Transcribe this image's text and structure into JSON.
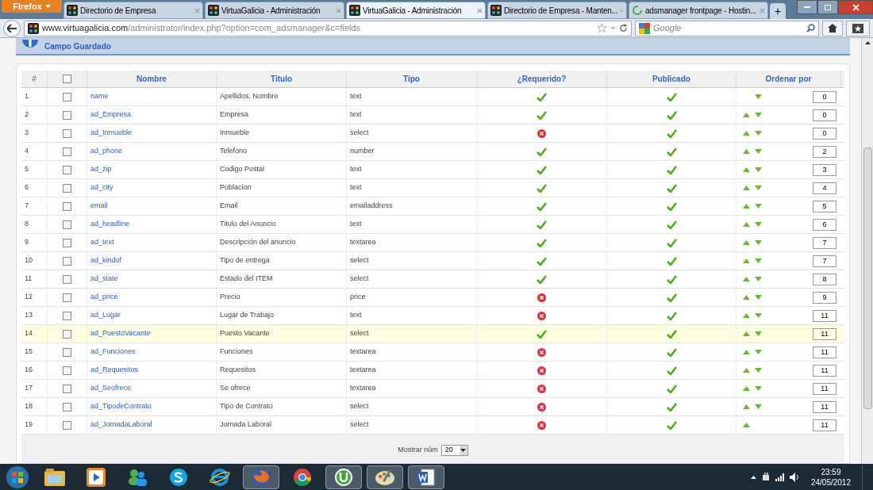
{
  "browser": {
    "menu_button": "Firefox",
    "tabs": [
      {
        "title": "Directorio de Empresa",
        "kind": "site",
        "selected": false
      },
      {
        "title": "VirtuaGalicia - Administración",
        "kind": "site",
        "selected": false
      },
      {
        "title": "VirtuaGalicia - Administración",
        "kind": "site",
        "selected": true
      },
      {
        "title": "Directorio de Empresa - Manten...",
        "kind": "site",
        "selected": false
      },
      {
        "title": "adsmanager frontpage - Hostin...",
        "kind": "loading",
        "selected": false
      }
    ],
    "new_tab": "+",
    "address_domain": "www.virtuagalicia.com",
    "address_path": "/administrator/index.php?option=com_adsmanager&c=fields",
    "search_placeholder": "Google"
  },
  "message": "Campo Guardado",
  "table": {
    "select_all_checked": false,
    "columns": [
      "#",
      "Nombre",
      "Titulo",
      "Tipo",
      "¿Requerido?",
      "Publicado",
      "Ordenar por"
    ],
    "rows": [
      {
        "num": "1",
        "name": "name",
        "title": "Apellidos, Nombre",
        "type": "text",
        "required": true,
        "published": true,
        "move_up": false,
        "move_down": true,
        "order": "0",
        "highlighted": false
      },
      {
        "num": "2",
        "name": "ad_Empresa",
        "title": "Empresa",
        "type": "text",
        "required": true,
        "published": true,
        "move_up": true,
        "move_down": true,
        "order": "0",
        "highlighted": false
      },
      {
        "num": "3",
        "name": "ad_Inmueble",
        "title": "Inmueble",
        "type": "select",
        "required": false,
        "published": true,
        "move_up": true,
        "move_down": true,
        "order": "0",
        "highlighted": false
      },
      {
        "num": "4",
        "name": "ad_phone",
        "title": "Telefono",
        "type": "number",
        "required": true,
        "published": true,
        "move_up": true,
        "move_down": true,
        "order": "2",
        "highlighted": false
      },
      {
        "num": "5",
        "name": "ad_zip",
        "title": "Codigo Postal",
        "type": "text",
        "required": true,
        "published": true,
        "move_up": true,
        "move_down": true,
        "order": "3",
        "highlighted": false
      },
      {
        "num": "6",
        "name": "ad_city",
        "title": "Poblacion",
        "type": "text",
        "required": true,
        "published": true,
        "move_up": true,
        "move_down": true,
        "order": "4",
        "highlighted": false
      },
      {
        "num": "7",
        "name": "email",
        "title": "Email",
        "type": "emailaddress",
        "required": true,
        "published": true,
        "move_up": true,
        "move_down": true,
        "order": "5",
        "highlighted": false
      },
      {
        "num": "8",
        "name": "ad_headline",
        "title": "Titulo del Anuncio",
        "type": "text",
        "required": true,
        "published": true,
        "move_up": true,
        "move_down": true,
        "order": "6",
        "highlighted": false
      },
      {
        "num": "9",
        "name": "ad_text",
        "title": "Descripción del anuncio",
        "type": "textarea",
        "required": true,
        "published": true,
        "move_up": true,
        "move_down": true,
        "order": "7",
        "highlighted": false
      },
      {
        "num": "10",
        "name": "ad_kindof",
        "title": "Tipo de entrega",
        "type": "select",
        "required": true,
        "published": true,
        "move_up": true,
        "move_down": true,
        "order": "7",
        "highlighted": false
      },
      {
        "num": "11",
        "name": "ad_state",
        "title": "Estado del ITEM",
        "type": "select",
        "required": true,
        "published": true,
        "move_up": true,
        "move_down": true,
        "order": "8",
        "highlighted": false
      },
      {
        "num": "12",
        "name": "ad_price",
        "title": "Precio",
        "type": "price",
        "required": false,
        "published": true,
        "move_up": true,
        "move_down": true,
        "order": "9",
        "highlighted": false
      },
      {
        "num": "13",
        "name": "ad_Lugar",
        "title": "Lugar de Trabajo",
        "type": "text",
        "required": false,
        "published": true,
        "move_up": true,
        "move_down": true,
        "order": "11",
        "highlighted": false
      },
      {
        "num": "14",
        "name": "ad_PuestoVacante",
        "title": "Puesto Vacante",
        "type": "select",
        "required": true,
        "published": true,
        "move_up": true,
        "move_down": true,
        "order": "11",
        "highlighted": true
      },
      {
        "num": "15",
        "name": "ad_Funciones",
        "title": "Funciones",
        "type": "textarea",
        "required": false,
        "published": true,
        "move_up": true,
        "move_down": true,
        "order": "11",
        "highlighted": false
      },
      {
        "num": "16",
        "name": "ad_Requesitos",
        "title": "Requesitos",
        "type": "textarea",
        "required": false,
        "published": true,
        "move_up": true,
        "move_down": true,
        "order": "11",
        "highlighted": false
      },
      {
        "num": "17",
        "name": "ad_Seofrece",
        "title": "Se ofrece",
        "type": "textarea",
        "required": false,
        "published": true,
        "move_up": true,
        "move_down": true,
        "order": "11",
        "highlighted": false
      },
      {
        "num": "18",
        "name": "ad_TipodeContrato",
        "title": "Tipo de Contrato",
        "type": "select",
        "required": false,
        "published": true,
        "move_up": true,
        "move_down": true,
        "order": "11",
        "highlighted": false
      },
      {
        "num": "19",
        "name": "ad_JornadaLaboral",
        "title": "Jornada Laboral",
        "type": "select",
        "required": false,
        "published": true,
        "move_up": true,
        "move_down": false,
        "order": "11",
        "highlighted": false
      }
    ],
    "footer_label": "Mostrar núm",
    "page_size": "20"
  },
  "taskbar": {
    "apps": [
      {
        "kind": "explorer",
        "active": false
      },
      {
        "kind": "media",
        "active": false
      },
      {
        "kind": "messenger",
        "active": false
      },
      {
        "kind": "skype",
        "active": false
      },
      {
        "kind": "ie",
        "active": false
      },
      {
        "kind": "firefox",
        "active": true
      },
      {
        "kind": "chrome",
        "active": false
      },
      {
        "kind": "torrent",
        "active": true
      },
      {
        "kind": "paint",
        "active": true
      },
      {
        "kind": "word",
        "active": true
      }
    ],
    "time": "23:59",
    "date": "24/05/2012"
  }
}
